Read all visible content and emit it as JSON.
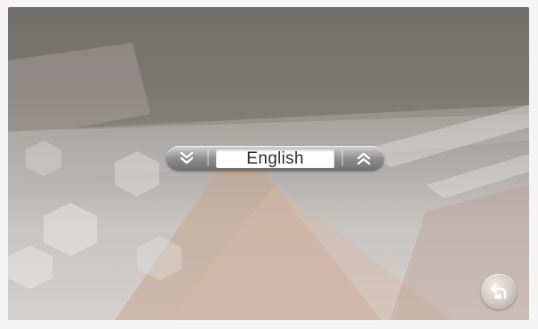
{
  "language_selector": {
    "value": "English",
    "prev_icon": "double-chevron-down-icon",
    "next_icon": "double-chevron-up-icon"
  },
  "back_button": {
    "icon": "return-arrow-icon"
  },
  "colors": {
    "background_dark": "#77736f",
    "background_light": "#d3d0cd",
    "accent_warm": "#c9a58f",
    "value_box": "#ffffff"
  }
}
